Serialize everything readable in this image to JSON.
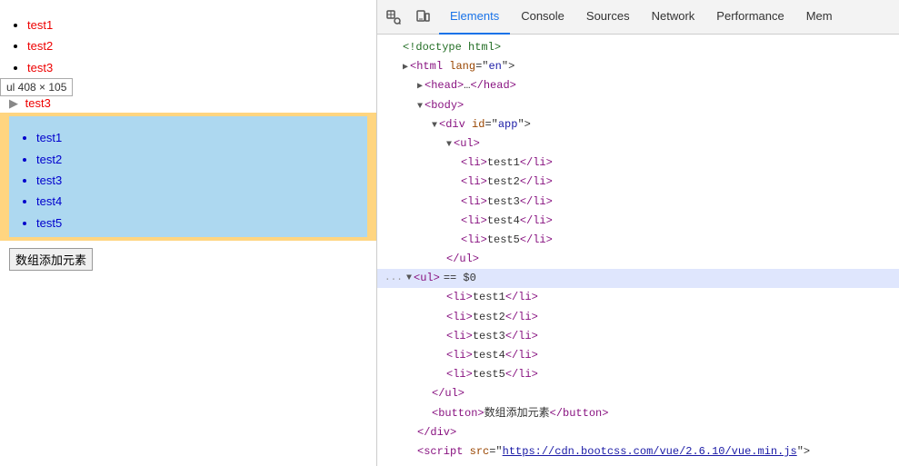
{
  "left": {
    "top_list": {
      "items": [
        "test1",
        "test2",
        "test3"
      ]
    },
    "tooltip": {
      "text": "ul  408 × 105"
    },
    "collapsed_item": "test3",
    "highlighted_list": {
      "items": [
        "test1",
        "test2",
        "test3",
        "test4",
        "test5"
      ]
    },
    "button_label": "数组添加元素"
  },
  "devtools": {
    "tabs": [
      {
        "label": "Elements",
        "active": true
      },
      {
        "label": "Console",
        "active": false
      },
      {
        "label": "Sources",
        "active": false
      },
      {
        "label": "Network",
        "active": false
      },
      {
        "label": "Performance",
        "active": false
      },
      {
        "label": "Mem",
        "active": false
      }
    ],
    "code_lines": [
      {
        "indent": 1,
        "content": "<!doctype html>",
        "type": "comment"
      },
      {
        "indent": 1,
        "content": "<html lang=\"en\">",
        "type": "tag"
      },
      {
        "indent": 2,
        "content": "▶ <head>…</head>",
        "type": "collapsed"
      },
      {
        "indent": 2,
        "content": "▼ <body>",
        "type": "tag"
      },
      {
        "indent": 3,
        "content": "▼ <div id=\"app\">",
        "type": "tag"
      },
      {
        "indent": 4,
        "content": "▼ <ul>",
        "type": "tag"
      },
      {
        "indent": 5,
        "content": "<li>test1</li>",
        "type": "tag"
      },
      {
        "indent": 5,
        "content": "<li>test2</li>",
        "type": "tag"
      },
      {
        "indent": 5,
        "content": "<li>test3</li>",
        "type": "tag"
      },
      {
        "indent": 5,
        "content": "<li>test4</li>",
        "type": "tag"
      },
      {
        "indent": 5,
        "content": "<li>test5</li>",
        "type": "tag"
      },
      {
        "indent": 4,
        "content": "</ul>",
        "type": "tag"
      },
      {
        "indent": 3,
        "content": "<ul> == $0",
        "type": "selected"
      },
      {
        "indent": 4,
        "content": "<li>test1</li>",
        "type": "tag"
      },
      {
        "indent": 4,
        "content": "<li>test2</li>",
        "type": "tag"
      },
      {
        "indent": 4,
        "content": "<li>test3</li>",
        "type": "tag"
      },
      {
        "indent": 4,
        "content": "<li>test4</li>",
        "type": "tag"
      },
      {
        "indent": 4,
        "content": "<li>test5</li>",
        "type": "tag"
      },
      {
        "indent": 3,
        "content": "</ul>",
        "type": "tag"
      },
      {
        "indent": 3,
        "content": "<button>数组添加元素</button>",
        "type": "tag"
      },
      {
        "indent": 2,
        "content": "</div>",
        "type": "tag"
      },
      {
        "indent": 2,
        "content": "<script src=\"https://cdn.bootcss.com/vue/2.6.10/vue.min.js\">",
        "type": "script"
      }
    ]
  }
}
